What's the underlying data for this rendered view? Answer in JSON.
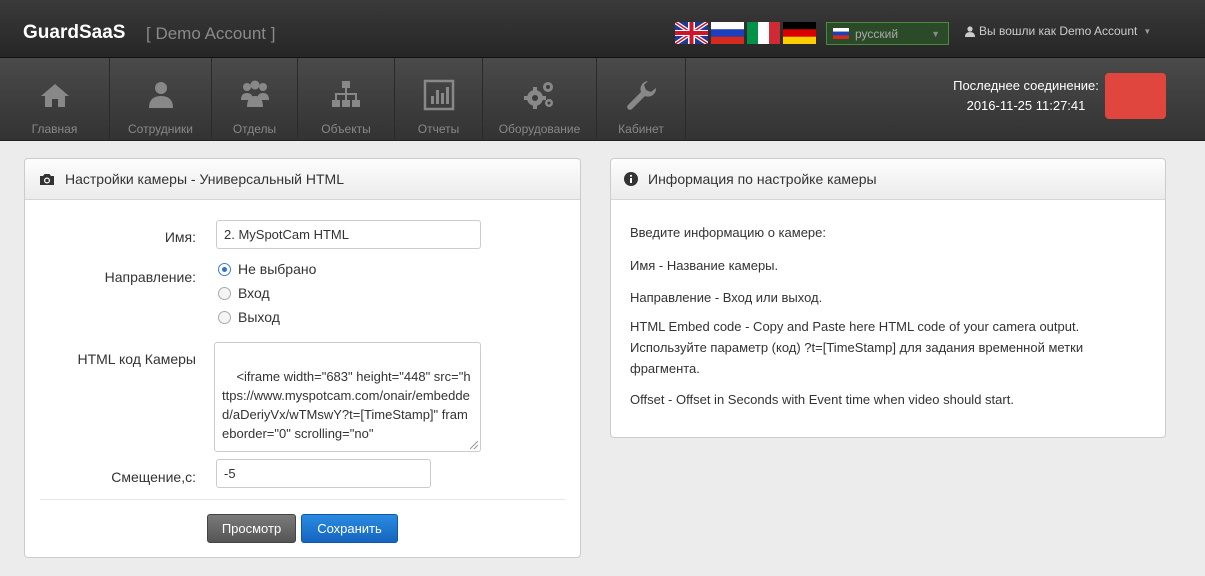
{
  "topbar": {
    "brand": "GuardSaaS",
    "account_tag": "[ Demo Account ]",
    "flags": [
      "flag-uk-icon",
      "flag-ru-icon",
      "flag-it-icon",
      "flag-de-icon"
    ],
    "language": "русский",
    "user_label": "Вы вошли как Demo Account"
  },
  "nav": {
    "items": [
      {
        "label": "Главная",
        "icon": "home-icon"
      },
      {
        "label": "Сотрудники",
        "icon": "user-icon"
      },
      {
        "label": "Отделы",
        "icon": "users-icon"
      },
      {
        "label": "Объекты",
        "icon": "sitemap-icon"
      },
      {
        "label": "Отчеты",
        "icon": "chart-icon"
      },
      {
        "label": "Оборудование",
        "icon": "gears-icon"
      },
      {
        "label": "Кабинет",
        "icon": "wrench-icon"
      }
    ],
    "last_connection_label": "Последнее соединение:",
    "last_connection_value": "2016-11-25 11:27:41",
    "status_color": "#e0463e"
  },
  "form": {
    "title": "Настройки камеры - Универсальный HTML",
    "name_label": "Имя:",
    "name_value": "2. MySpotCam HTML",
    "direction_label": "Направление:",
    "direction_options": [
      "Не выбрано",
      "Вход",
      "Выход"
    ],
    "direction_selected": "Не выбрано",
    "html_label": "HTML код Камеры",
    "html_value": "<iframe width=\"683\" height=\"448\" src=\"https://www.myspotcam.com/onair/embedded/aDeriyVx/wTMswY?t=[TimeStamp]\" frameborder=\"0\" scrolling=\"no\"",
    "offset_label": "Смещение,с:",
    "offset_value": "-5",
    "preview_button": "Просмотр",
    "save_button": "Сохранить"
  },
  "info": {
    "title": "Информация по настройке камеры",
    "lines": [
      "Введите информацию о камере:",
      "Имя - Название камеры.",
      "Направление - Вход или выход.",
      "HTML Embed code - Copy and Paste here HTML code of your camera output. Используйте параметр (код) ?t=[TimeStamp] для задания временной метки фрагмента.",
      "Offset - Offset in Seconds with Event time when video should start."
    ]
  }
}
